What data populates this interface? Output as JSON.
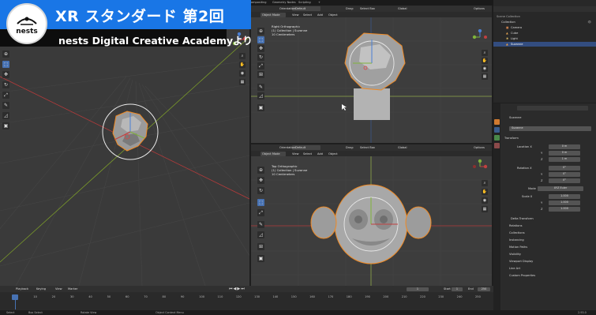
{
  "overlay": {
    "title": "XR スタンダード 第2回",
    "subtitle": "nests Digital Creative Academyより",
    "logo_text": "nests"
  },
  "topbar": {
    "workspaces": [
      "ompositing",
      "Geometry Nodes",
      "Scripting",
      "+"
    ],
    "scene_label": "Scene",
    "view_layer_label": "View Layer"
  },
  "viewport_right_top": {
    "mode": "Object Mode",
    "menus": [
      "View",
      "Select",
      "Add",
      "Object"
    ],
    "orientation_label": "Orientation:",
    "orientation_value": "Default",
    "drag_label": "Drag:",
    "drag_value": "Select Box",
    "transform_value": "Global",
    "options_label": "Options",
    "info_lines": [
      "Right Orthographic",
      "(1) Collection | Suzanne",
      "10 Centimeters"
    ]
  },
  "viewport_right_bottom": {
    "mode": "Object Mode",
    "menus": [
      "View",
      "Select",
      "Add",
      "Object"
    ],
    "orientation_label": "Orientation:",
    "orientation_value": "Default",
    "drag_label": "Drag:",
    "drag_value": "Select Box",
    "transform_value": "Global",
    "options_label": "Options",
    "info_lines": [
      "Top Orthographic",
      "(1) Collection | Suzanne",
      "10 Centimeters"
    ]
  },
  "outliner": {
    "root": "Scene Collection",
    "items": [
      {
        "label": "Collection",
        "selected": false
      },
      {
        "label": "Camera",
        "selected": false
      },
      {
        "label": "Cube",
        "selected": false
      },
      {
        "label": "Light",
        "selected": false
      },
      {
        "label": "Suzanne",
        "selected": true
      }
    ]
  },
  "properties": {
    "search_placeholder": "",
    "object_header": "Suzanne",
    "object_name": "Suzanne",
    "transform_header": "Transform",
    "location": {
      "label_x": "Location X",
      "label_y": "Y",
      "label_z": "Z",
      "x": "0 m",
      "y": "0 m",
      "z": "1 m"
    },
    "rotation": {
      "label_x": "Rotation X",
      "label_y": "Y",
      "label_z": "Z",
      "x": "0°",
      "y": "0°",
      "z": "0°"
    },
    "mode": {
      "label": "Mode",
      "value": "XYZ Euler"
    },
    "scale": {
      "label_x": "Scale X",
      "label_y": "Y",
      "label_z": "Z",
      "x": "1.000",
      "y": "1.000",
      "z": "1.000"
    },
    "panels": [
      "Delta Transform",
      "Relations",
      "Collections",
      "Instancing",
      "Motion Paths",
      "Visibility",
      "Viewport Display",
      "Line Art",
      "Custom Properties"
    ]
  },
  "timeline": {
    "menus": [
      "Playback",
      "Keying",
      "View",
      "Marker"
    ],
    "current_frame": "1",
    "start_label": "Start",
    "start_value": "1",
    "end_label": "End",
    "end_value": "250",
    "ticks": [
      "1",
      "10",
      "20",
      "30",
      "40",
      "50",
      "60",
      "70",
      "80",
      "90",
      "100",
      "110",
      "120",
      "130",
      "140",
      "150",
      "160",
      "170",
      "180",
      "190",
      "200",
      "210",
      "220",
      "230",
      "240",
      "250"
    ]
  },
  "statusbar": {
    "select": "Select",
    "box_select": "Box Select",
    "rotate_view": "Rotate View",
    "context_menu": "Object Context Menu",
    "version": "2.93.0"
  },
  "colors": {
    "accent": "#4772b3",
    "title_bar": "#1976e6",
    "selection_outline": "#f08a24",
    "x_axis": "#c0392b",
    "y_axis": "#8cb33a"
  }
}
